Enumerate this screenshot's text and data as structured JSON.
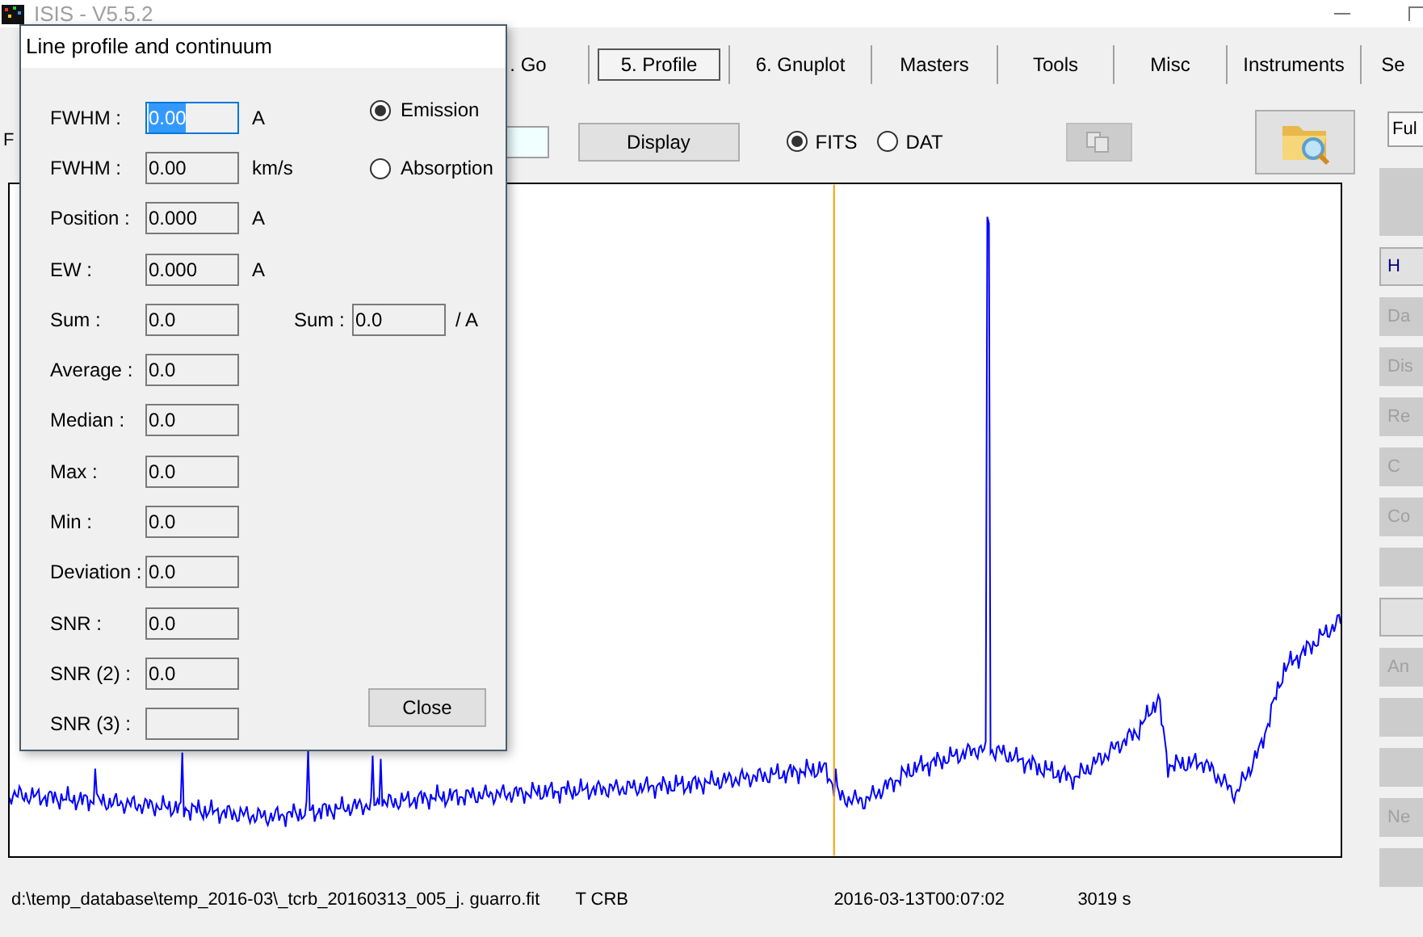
{
  "window": {
    "title": "ISIS - V5.5.2"
  },
  "tabs": [
    {
      "label": ". Go",
      "selected": false
    },
    {
      "label": "5. Profile",
      "selected": true
    },
    {
      "label": "6. Gnuplot",
      "selected": false
    },
    {
      "label": "Masters",
      "selected": false
    },
    {
      "label": "Tools",
      "selected": false
    },
    {
      "label": "Misc",
      "selected": false
    },
    {
      "label": "Instruments",
      "selected": false
    },
    {
      "label": "Se",
      "selected": false
    }
  ],
  "toolbar": {
    "label": "F",
    "display_button": "Display",
    "format_options": [
      {
        "label": "FITS",
        "selected": true
      },
      {
        "label": "DAT",
        "selected": false
      }
    ],
    "copy_button": {
      "disabled": true
    },
    "mode_dropdown": {
      "value": "Ful"
    }
  },
  "side_buttons": [
    {
      "disabled": true
    },
    {
      "label": "H",
      "disabled": false
    },
    {
      "label": "Da",
      "disabled": true
    },
    {
      "label": "Dis",
      "disabled": true
    },
    {
      "label": "Re",
      "disabled": true
    },
    {
      "label": "C",
      "disabled": true
    },
    {
      "label": "Co",
      "disabled": true
    },
    {
      "disabled": true
    },
    {
      "disabled": false
    },
    {
      "label": "An",
      "disabled": true
    },
    {
      "disabled": true
    },
    {
      "disabled": true
    },
    {
      "label": "Ne",
      "disabled": true
    },
    {
      "disabled": true
    }
  ],
  "status_bar": {
    "path": "d:\\temp_database\\temp_2016-03\\_tcrb_20160313_005_j. guarro.fit",
    "object": "T CRB",
    "date": "2016-03-13T00:07:02",
    "exposure": "3019 s"
  },
  "dialog": {
    "title": "Line profile and continuum",
    "fields": [
      {
        "label": "FWHM :",
        "value": "0.00",
        "unit": "A",
        "focused": true
      },
      {
        "label": "FWHM :",
        "value": "0.00",
        "unit": "km/s",
        "focused": false
      },
      {
        "label": "Position :",
        "value": "0.000",
        "unit": "A",
        "focused": false
      },
      {
        "label": "EW :",
        "value": "0.000",
        "unit": "A",
        "focused": false
      },
      {
        "label": "Sum :",
        "value": "0.0",
        "focused": false
      },
      {
        "label": "Average :",
        "value": "0.0",
        "focused": false
      },
      {
        "label": "Median :",
        "value": "0.0",
        "focused": false
      },
      {
        "label": "Max :",
        "value": "0.0",
        "focused": false
      },
      {
        "label": "Min :",
        "value": "0.0",
        "focused": false
      },
      {
        "label": "Deviation :",
        "value": "0.0",
        "focused": false
      },
      {
        "label": "SNR :",
        "value": "0.0",
        "focused": false
      },
      {
        "label": "SNR (2) :",
        "value": "0.0",
        "focused": false
      },
      {
        "label": "SNR (3) :",
        "focused": false
      }
    ],
    "sum_per_a": {
      "label": "Sum :",
      "value": "0.0",
      "unit": "/ A"
    },
    "line_type": [
      {
        "label": "Emission",
        "selected": true
      },
      {
        "label": "Absorption",
        "selected": false
      }
    ],
    "close_button": "Close"
  }
}
